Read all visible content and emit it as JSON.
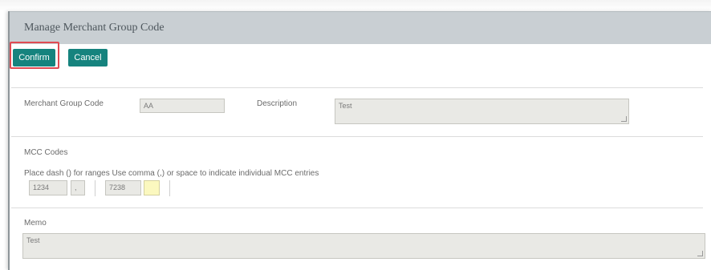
{
  "page": {
    "title": "Manage Merchant Group Code"
  },
  "toolbar": {
    "confirm_label": "Confirm",
    "cancel_label": "Cancel"
  },
  "form": {
    "merchant_group_code": {
      "label": "Merchant Group Code",
      "value": "AA"
    },
    "description": {
      "label": "Description",
      "value": "Test"
    },
    "mcc": {
      "section_label": "MCC Codes",
      "instructions": "Place dash () for ranges Use comma (,) or space to indicate individual MCC entries",
      "entries": [
        {
          "value": "1234"
        },
        {
          "value": ","
        },
        {
          "value": "7238"
        },
        {
          "value": ""
        }
      ]
    },
    "memo": {
      "label": "Memo",
      "value": "Test"
    }
  },
  "colors": {
    "button_bg": "#16837e",
    "header_bg": "#c9cfd3",
    "highlight_border": "#e04a52",
    "new_entry_bg": "#fbf8bf"
  }
}
